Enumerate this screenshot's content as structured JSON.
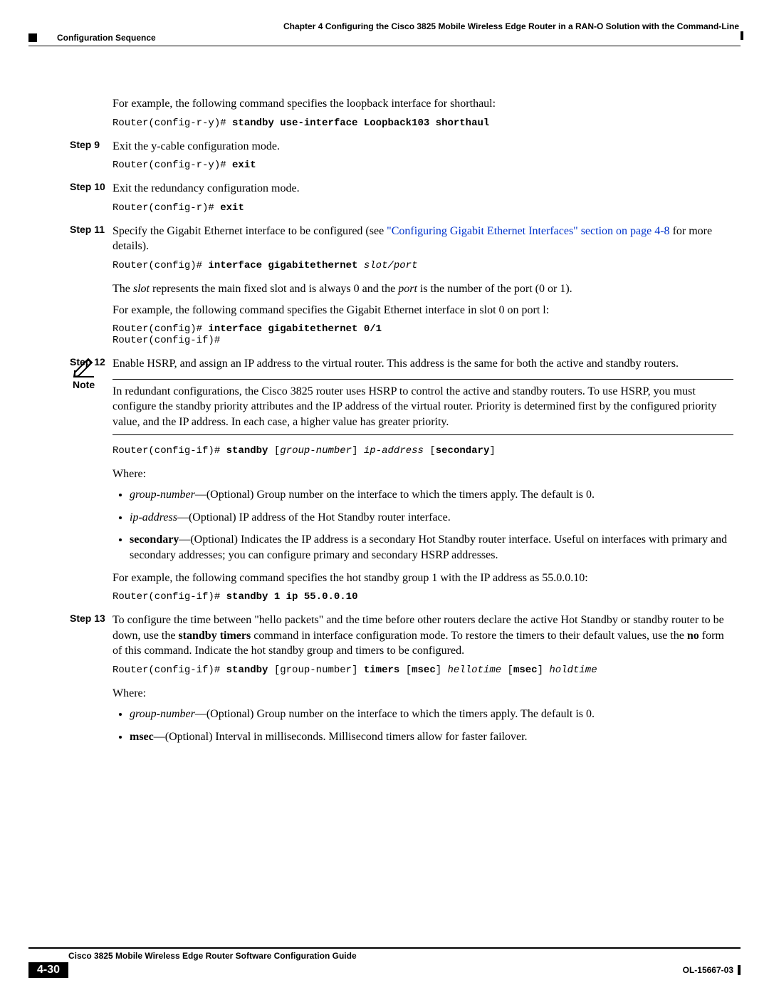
{
  "header": {
    "chapter_prefix": "Chapter 4",
    "chapter_spacer": "      ",
    "chapter_title": "Configuring the Cisco 3825 Mobile Wireless Edge Router in a RAN-O Solution with the Command-Line",
    "section_title": "Configuration Sequence"
  },
  "intro": {
    "para1": "For example, the following command specifies the loopback interface for shorthaul:",
    "code1_prompt": "Router(config-r-y)# ",
    "code1_cmd": "standby use-interface Loopback103 shorthaul"
  },
  "step9": {
    "label": "Step 9",
    "text": "Exit the y-cable configuration mode.",
    "code_prompt": "Router(config-r-y)# ",
    "code_cmd": "exit"
  },
  "step10": {
    "label": "Step 10",
    "text": "Exit the redundancy configuration mode.",
    "code_prompt": "Router(config-r)# ",
    "code_cmd": "exit"
  },
  "step11": {
    "label": "Step 11",
    "text_pre": "Specify the Gigabit Ethernet interface to be configured (see ",
    "link_text": "\"Configuring Gigabit Ethernet Interfaces\" section on page 4-8",
    "text_post": " for more details).",
    "code1_prompt": "Router(config)# ",
    "code1_cmd": "interface gigabitethernet ",
    "code1_arg": "slot/port",
    "slot_para_pre": "The ",
    "slot_word": "slot",
    "slot_para_mid": " represents the main fixed slot and is always 0 and the ",
    "port_word": "port",
    "slot_para_post": " is the number of the port (0 or 1).",
    "example_para": "For example, the following command specifies the Gigabit Ethernet interface in slot 0 on port l:",
    "code2_line1_prompt": "Router(config)# ",
    "code2_line1_cmd": "interface gigabitethernet 0/1",
    "code2_line2": "Router(config-if)#"
  },
  "step12": {
    "label": "Step 12",
    "text": "Enable HSRP, and assign an IP address to the virtual router. This address is the same for both the active and standby routers.",
    "note_label": "Note",
    "note_text": "In redundant configurations, the Cisco 3825 router uses HSRP to control the active and standby routers. To use HSRP, you must configure the standby priority attributes and the IP address of the virtual router. Priority is determined first by the configured priority value, and the IP address. In each case, a higher value has greater priority.",
    "code1_prompt": "Router(config-if)# ",
    "code1_cmd": "standby",
    "code1_open1": " [",
    "code1_arg1": "group-number",
    "code1_close1": "] ",
    "code1_arg2": "ip-address",
    "code1_open2": " [",
    "code1_cmd2": "secondary",
    "code1_close2": "]",
    "where": "Where:",
    "bullets": [
      {
        "term": "group-number",
        "desc": "—(Optional) Group number on the interface to which the timers apply. The default is 0.",
        "term_style": "italic"
      },
      {
        "term": "ip-address",
        "desc": "—(Optional) IP address of the Hot Standby router interface.",
        "term_style": "italic"
      },
      {
        "term": "secondary",
        "desc": "—(Optional) Indicates the IP address is a secondary Hot Standby router interface. Useful on interfaces with primary and secondary addresses; you can configure primary and secondary HSRP addresses.",
        "term_style": "bold"
      }
    ],
    "example_para": "For example, the following command specifies the hot standby group 1 with the IP address as 55.0.0.10:",
    "code2_prompt": "Router(config-if)# ",
    "code2_cmd": "standby 1 ip 55.0.0.10"
  },
  "step13": {
    "label": "Step 13",
    "text_pre": "To configure the time between \"hello packets\" and the time before other routers declare the active Hot Standby or standby router to be down, use the ",
    "bold1": "standby timers",
    "text_mid": " command in interface configuration mode. To restore the timers to their default values, use the ",
    "bold2": "no",
    "text_post": " form of this command. Indicate the hot standby group and timers to be configured.",
    "code_prompt": "Router(config-if)# ",
    "code_cmd1": "standby",
    "code_br1": " [group-number] ",
    "code_cmd2": "timers",
    "code_sp1": " [",
    "code_cmd3": "msec",
    "code_sp2": "] ",
    "code_arg1": "hellotime",
    "code_sp3": " [",
    "code_cmd4": "msec",
    "code_sp4": "] ",
    "code_arg2": "holdtime",
    "where": "Where:",
    "bullets": [
      {
        "term": "group-number",
        "desc": "—(Optional) Group number on the interface to which the timers apply. The default is 0.",
        "term_style": "italic"
      },
      {
        "term": "msec",
        "desc": "—(Optional) Interval in milliseconds. Millisecond timers allow for faster failover.",
        "term_style": "bold"
      }
    ]
  },
  "footer": {
    "guide_title": "Cisco 3825 Mobile Wireless Edge Router Software Configuration Guide",
    "page_number": "4-30",
    "doc_id": "OL-15667-03"
  }
}
